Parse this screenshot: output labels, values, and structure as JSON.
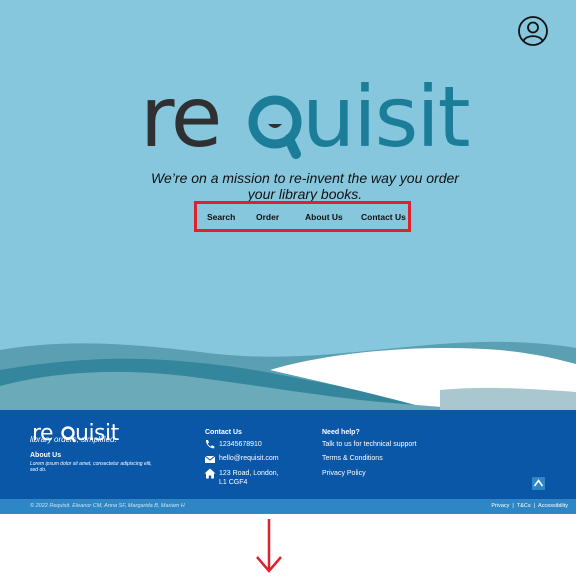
{
  "header": {
    "profile_icon": "user-circle-icon"
  },
  "hero": {
    "logo_text": "requisit",
    "tagline": "We’re on a mission to re-invent the way you order your library books."
  },
  "nav": {
    "items": [
      {
        "label": "Search"
      },
      {
        "label": "Order"
      },
      {
        "label": "About Us"
      },
      {
        "label": "Contact Us"
      }
    ],
    "highlight_color": "#e0202a"
  },
  "footer": {
    "logo_text": "requisit",
    "slogan": "library orders, simplified.",
    "about_title": "About Us",
    "about_text": "Lorem ipsum dolor sit amet, consectetur adipiscing elit, sed do.",
    "contact": {
      "title": "Contact Us",
      "phone": "12345678910",
      "email": "hello@requisit.com",
      "address_line1": "123 Road, London,",
      "address_line2": "L1 CGF4"
    },
    "help": {
      "title": "Need help?",
      "links": [
        "Talk to us for technical support",
        "Terms & Conditions",
        "Privacy Policy"
      ]
    },
    "scroll_top_icon": "arrow-up-icon"
  },
  "bottom_bar": {
    "copyright": "© 2022 Requisit. Eleanor CM, Anna SF, Margarida B, Mariam H",
    "privacy": "Privacy",
    "sep1": "|",
    "tcs": "T&Cs",
    "sep2": "|",
    "accessibility": "Accessibility"
  },
  "annotation": {
    "arrow_icon": "arrow-down-icon",
    "color": "#e0202a"
  },
  "colors": {
    "hero_bg": "#86c7dd",
    "brand_dark": "#2e3032",
    "brand_teal": "#1b7d98",
    "footer_bg": "#0a57a8",
    "bottom_bar_bg": "#2f86c4"
  }
}
